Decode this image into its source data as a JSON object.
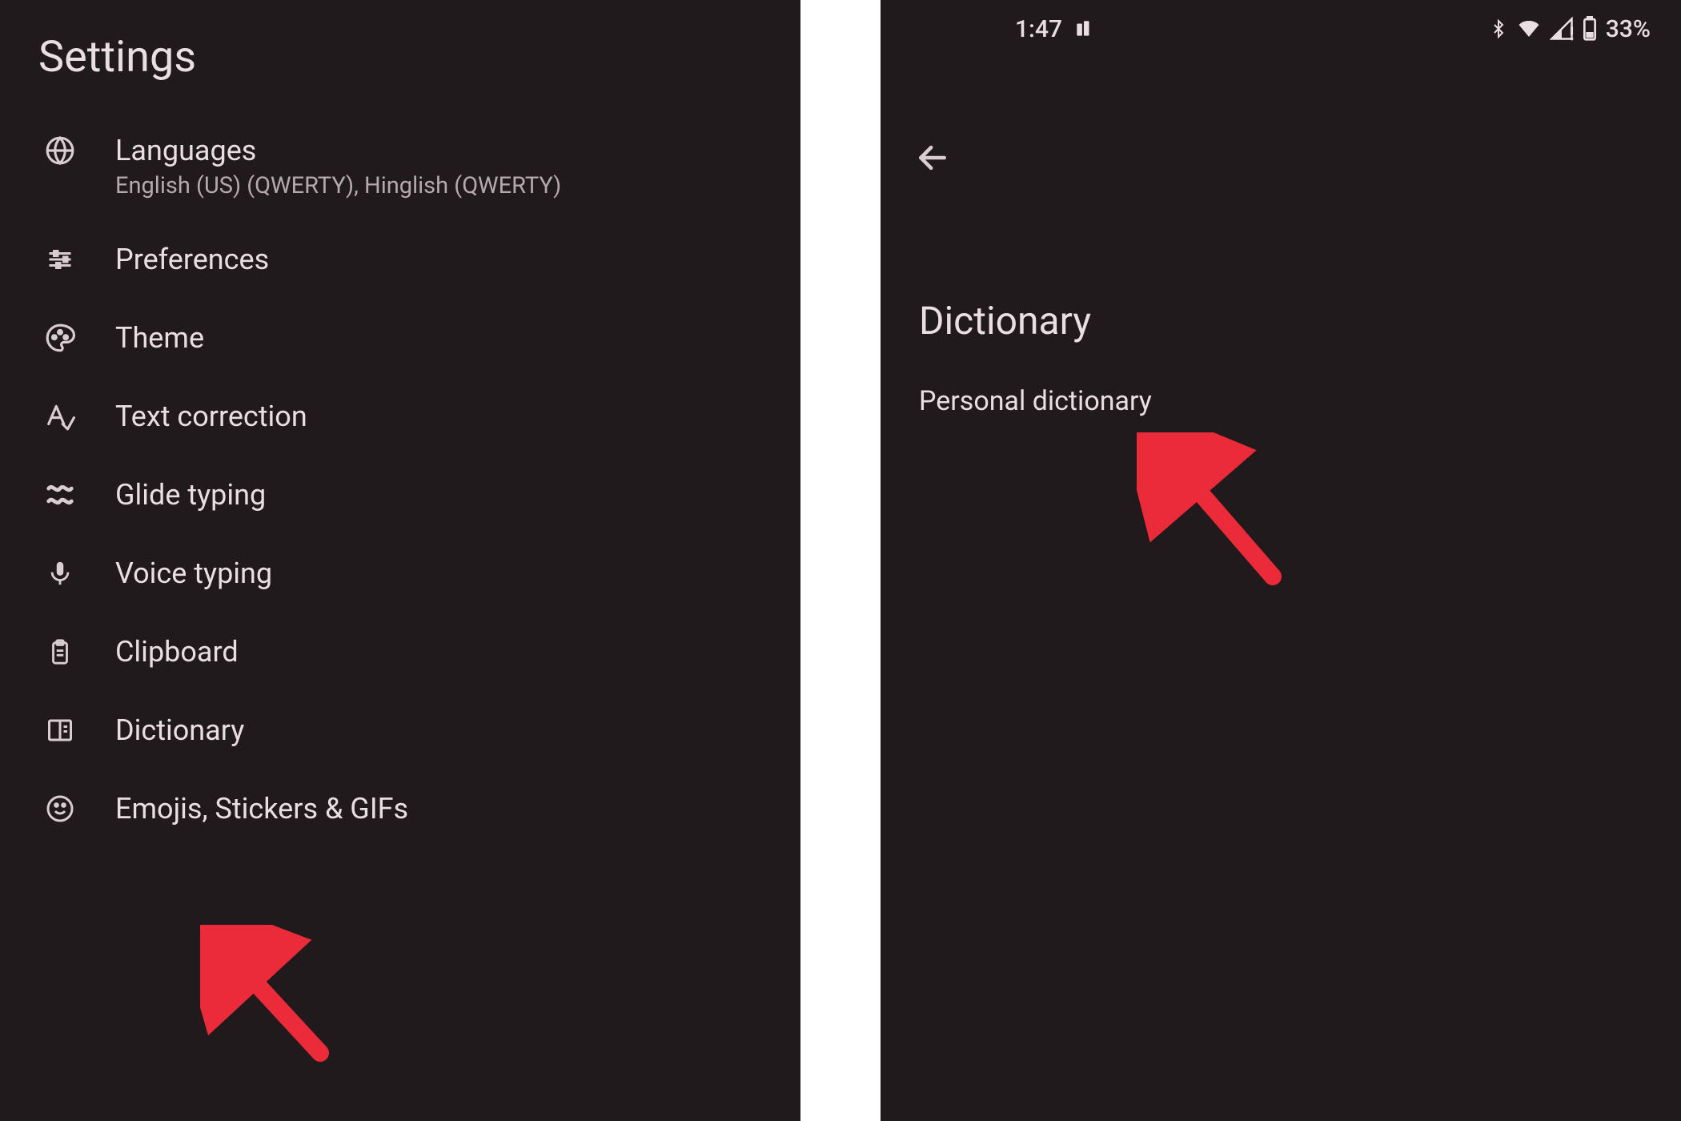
{
  "left": {
    "header": "Settings",
    "items": [
      {
        "title": "Languages",
        "subtitle": "English (US) (QWERTY), Hinglish (QWERTY)",
        "icon": "globe-icon"
      },
      {
        "title": "Preferences",
        "icon": "sliders-icon"
      },
      {
        "title": "Theme",
        "icon": "palette-icon"
      },
      {
        "title": "Text correction",
        "icon": "text-correction-icon"
      },
      {
        "title": "Glide typing",
        "icon": "glide-icon"
      },
      {
        "title": "Voice typing",
        "icon": "mic-icon"
      },
      {
        "title": "Clipboard",
        "icon": "clipboard-icon"
      },
      {
        "title": "Dictionary",
        "icon": "book-icon"
      },
      {
        "title": "Emojis, Stickers & GIFs",
        "icon": "smile-icon"
      }
    ]
  },
  "right": {
    "status": {
      "time": "1:47",
      "battery_pct": "33%"
    },
    "title": "Dictionary",
    "items": [
      {
        "title": "Personal dictionary"
      }
    ]
  },
  "annotations": {
    "arrow_color": "#eb2a3a"
  }
}
